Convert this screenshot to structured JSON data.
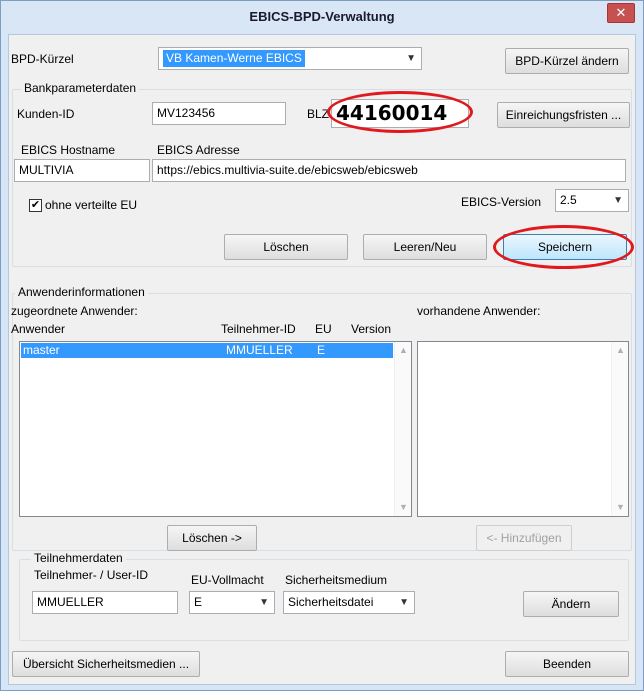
{
  "window": {
    "title": "EBICS-BPD-Verwaltung",
    "close_glyph": "✕"
  },
  "bpd": {
    "label": "BPD-Kürzel",
    "selected": "VB Kamen-Werne EBICS",
    "change_button": "BPD-Kürzel ändern"
  },
  "bank": {
    "group_title": "Bankparameterdaten",
    "kunden_label": "Kunden-ID",
    "kunden_value": "MV123456",
    "blz_label": "BLZ",
    "blz_value": "44160014",
    "fristen_button": "Einreichungsfristen ...",
    "host_label": "EBICS Hostname",
    "host_value": "MULTIVIA",
    "adresse_label": "EBICS Adresse",
    "adresse_value": "https://ebics.multivia-suite.de/ebicsweb/ebicsweb",
    "checkbox_label": "ohne verteilte EU",
    "checkbox_checked": "✔",
    "version_label": "EBICS-Version",
    "version_value": "2.5",
    "delete_button": "Löschen",
    "clear_button": "Leeren/Neu",
    "save_button": "Speichern"
  },
  "users": {
    "group_title": "Anwenderinformationen",
    "assigned_label": "zugeordnete Anwender:",
    "available_label": "vorhandene Anwender:",
    "columns": [
      "Anwender",
      "Teilnehmer-ID",
      "EU",
      "Version"
    ],
    "rows": [
      {
        "anwender": "master",
        "teilnehmer": "MMUELLER",
        "eu": "E",
        "version": ""
      }
    ],
    "remove_button": "Löschen ->",
    "add_button": "<- Hinzufügen"
  },
  "participant": {
    "group_title": "Teilnehmerdaten",
    "id_label": "Teilnehmer- / User-ID",
    "id_value": "MMUELLER",
    "eu_label": "EU-Vollmacht",
    "eu_value": "E",
    "medium_label": "Sicherheitsmedium",
    "medium_value": "Sicherheitsdatei",
    "change_button": "Ändern"
  },
  "footer": {
    "overview_button": "Übersicht Sicherheitsmedien ...",
    "exit_button": "Beenden"
  },
  "colors": {
    "highlight_oval": "#e0191e",
    "selection": "#3399ff"
  }
}
